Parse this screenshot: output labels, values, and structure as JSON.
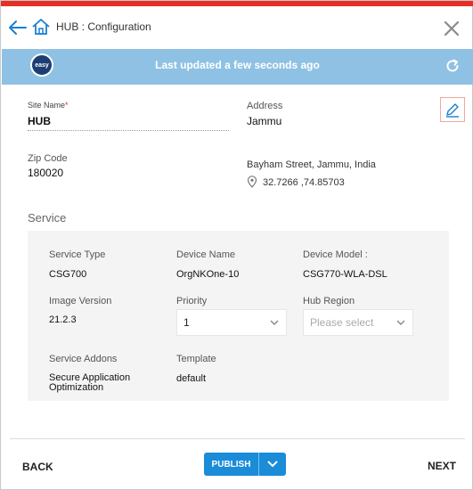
{
  "header": {
    "title": "HUB : Configuration"
  },
  "status_bar": {
    "badge_label": "easy",
    "message": "Last updated a few seconds ago"
  },
  "site": {
    "site_name_label": "Site Name",
    "required_mark": "*",
    "site_name_value": "HUB",
    "address_label": "Address",
    "address_value": "Jammu",
    "zip_label": "Zip Code",
    "zip_value": "180020",
    "street": "Bayham Street, Jammu, India",
    "coordinates": "32.7266 ,74.85703"
  },
  "service": {
    "section_title": "Service",
    "service_type_label": "Service Type",
    "service_type_value": "CSG700",
    "device_name_label": "Device Name",
    "device_name_value": "OrgNKOne-10",
    "device_model_label": "Device Model :",
    "device_model_value": "CSG770-WLA-DSL",
    "image_version_label": "Image Version",
    "image_version_value": "21.2.3",
    "priority_label": "Priority",
    "priority_value": "1",
    "hub_region_label": "Hub Region",
    "hub_region_placeholder": "Please select",
    "service_addons_label": "Service Addons",
    "service_addons_value_line1": "Secure Application",
    "service_addons_value_line2": "Optimization",
    "template_label": "Template",
    "template_value": "default"
  },
  "footer": {
    "back_label": "BACK",
    "publish_label": "PUBLISH",
    "next_label": "NEXT"
  },
  "colors": {
    "accent_red": "#e63027",
    "status_bar_blue": "#8fc1e4",
    "primary_blue": "#1a8cd8",
    "badge_navy": "#1c3f73"
  }
}
